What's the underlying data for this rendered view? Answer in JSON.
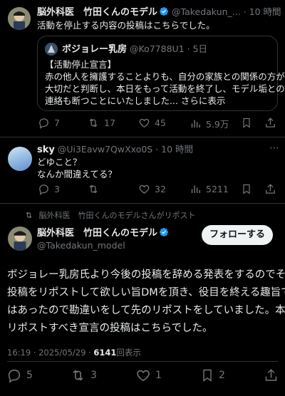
{
  "tweet1": {
    "author_name": "脳外科医　竹田くんのモデル",
    "handle": "@Takedakun_...",
    "time": "· 10 時間",
    "text": "活動を停止する内容の投稿はこちらでした。",
    "quote": {
      "author_name": "ボジョレー乳房",
      "handle": "@Ko7788U1 · 5日",
      "lines": [
        "【活動停止宣言】",
        "赤の他人を擁護することよりも、自分の家族との関係の方が",
        "大切だと判断し、本日をもって活動を終了し、モデル垢との",
        "連絡も断つことにいたしました... さらに表示"
      ]
    },
    "replies": "7",
    "reposts": "17",
    "likes": "45",
    "views": "5.9万"
  },
  "reply": {
    "author_name": "sky",
    "handle": "@Ui3Eavw7QwXxo0S · 10 時間",
    "line1": "どゆこと？",
    "line2": "なんか間違えてる？",
    "replies": "3",
    "reposts": "",
    "likes": "32",
    "views": "5211"
  },
  "main": {
    "repost_banner": "脳外科医　竹田くんのモデルさんがリポスト",
    "author_name": "脳外科医　竹田くんのモデル",
    "handle": "@Takedakun_model",
    "follow_label": "フォローする",
    "lines": [
      "ボジョレー乳房氏より今後の投稿を辞める発表をするのでその",
      "投稿をリポストして欲しい旨DMを頂き、役目を終える趣旨で",
      "はあったので勘違いをして先のリポストをしていました。本来",
      "リポストすべき宣言の投稿はこちらでした。"
    ],
    "timestamp": "16:19 · 2025/05/29 · ",
    "views_count": "6141",
    "views_label": "回表示",
    "replies": "5",
    "reposts": "3",
    "likes": "1",
    "bookmarks": "2"
  },
  "colors": {
    "background": "#000000",
    "text": "#e7e9ea",
    "muted": "#71767b",
    "verified": "#1d9bf0",
    "border": "#2f3336"
  },
  "icons": [
    "reply-icon",
    "repost-icon",
    "like-icon",
    "views-icon",
    "bookmark-icon",
    "share-icon",
    "verified-icon",
    "more-icon"
  ]
}
